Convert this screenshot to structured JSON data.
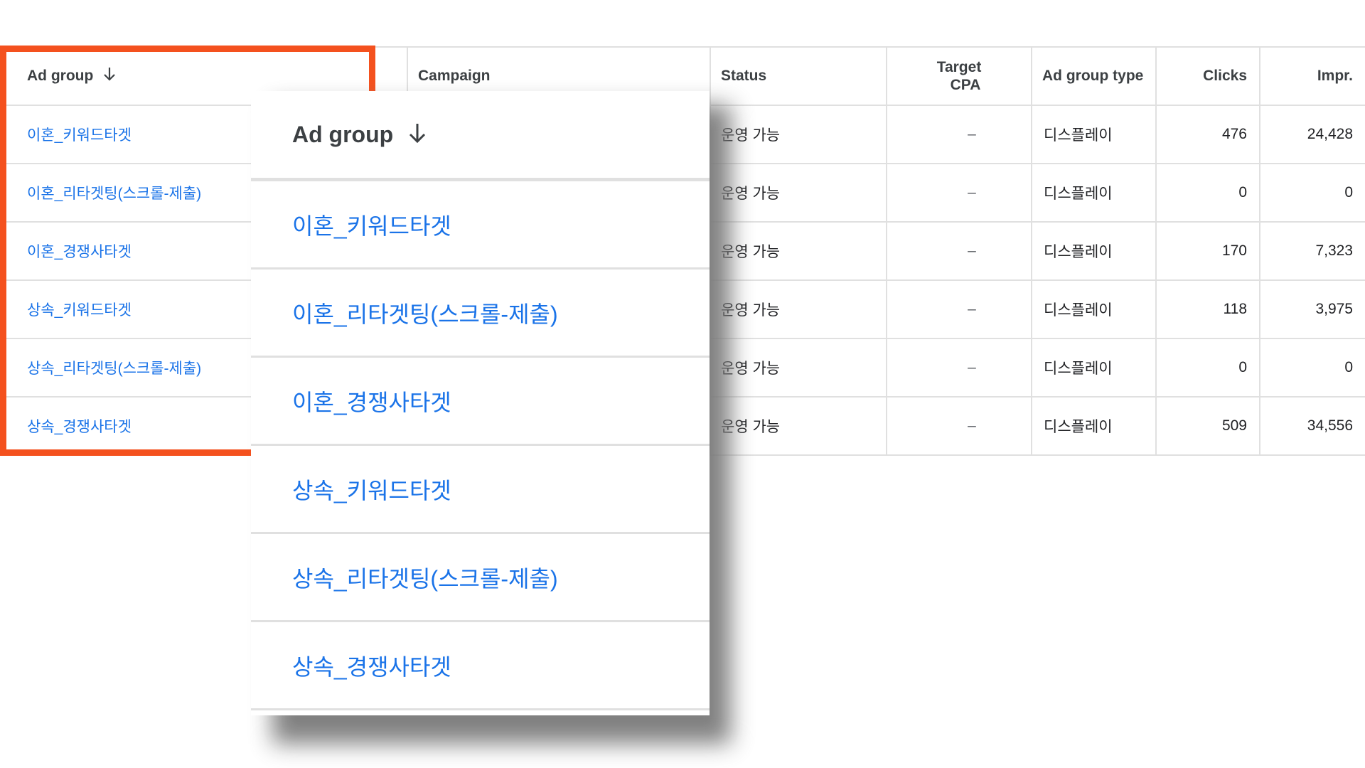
{
  "columns": {
    "ad_group": "Ad group",
    "campaign": "Campaign",
    "status": "Status",
    "target_cpa_line1": "Target",
    "target_cpa_line2": "CPA",
    "ad_group_type": "Ad group type",
    "clicks": "Clicks",
    "impr": "Impr."
  },
  "sort_icon": "arrow-down-icon",
  "rows": [
    {
      "ad_group": "이혼_키워드타겟",
      "status": "운영 가능",
      "target_cpa": "–",
      "type": "디스플레이",
      "clicks": "476",
      "impr": "24,428"
    },
    {
      "ad_group": "이혼_리타겟팅(스크롤-제출)",
      "status": "운영 가능",
      "target_cpa": "–",
      "type": "디스플레이",
      "clicks": "0",
      "impr": "0"
    },
    {
      "ad_group": "이혼_경쟁사타겟",
      "status": "운영 가능",
      "target_cpa": "–",
      "type": "디스플레이",
      "clicks": "170",
      "impr": "7,323"
    },
    {
      "ad_group": "상속_키워드타겟",
      "status": "운영 가능",
      "target_cpa": "–",
      "type": "디스플레이",
      "clicks": "118",
      "impr": "3,975"
    },
    {
      "ad_group": "상속_리타겟팅(스크롤-제출)",
      "status": "운영 가능",
      "target_cpa": "–",
      "type": "디스플레이",
      "clicks": "0",
      "impr": "0"
    },
    {
      "ad_group": "상속_경쟁사타겟",
      "status": "운영 가능",
      "target_cpa": "–",
      "type": "디스플레이",
      "clicks": "509",
      "impr": "34,556"
    }
  ],
  "colors": {
    "link": "#1a73e8",
    "highlight": "#f4511e",
    "divider": "#e0e0e0"
  }
}
